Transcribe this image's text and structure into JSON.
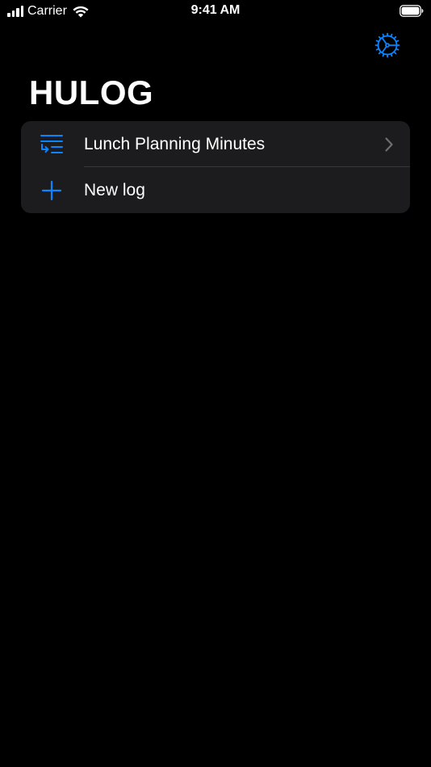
{
  "status_bar": {
    "carrier": "Carrier",
    "time": "9:41 AM"
  },
  "header": {
    "title": "HULOG",
    "settings_icon": "gear-icon"
  },
  "logs": {
    "items": [
      {
        "label": "Lunch Planning Minutes",
        "icon": "text-indent-icon",
        "accessory": "chevron-right-icon"
      }
    ],
    "new_log": {
      "label": "New log",
      "icon": "plus-icon"
    }
  },
  "colors": {
    "background": "#000000",
    "accent": "#0a84ff",
    "cell_background": "#1c1c1e",
    "separator": "#38383a",
    "chevron": "#6e6e73"
  }
}
